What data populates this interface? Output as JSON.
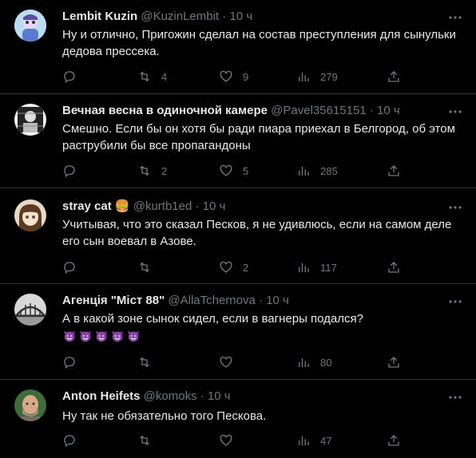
{
  "tweets": [
    {
      "name": "Lembit Kuzin",
      "handle": "@KuzinLembit",
      "dot": "·",
      "time": "10 ч",
      "text": "Ну и отлично, Пригожин сделал на состав преступления для сынульки дедова прессека.",
      "replies": "",
      "retweets": "4",
      "likes": "9",
      "views": "279"
    },
    {
      "name": "Вечная весна в одиночной камере",
      "handle": "@Pavel35615151",
      "dot": "·",
      "time": "10 ч",
      "text": "Смешно. Если бы он хотя бы ради пиара приехал в Белгород, об этом раструбили бы все пропагандоны",
      "replies": "",
      "retweets": "2",
      "likes": "5",
      "views": "285"
    },
    {
      "name": "stray cat 🍔",
      "handle": "@kurtb1ed",
      "dot": "·",
      "time": "10 ч",
      "text": "Учитывая, что это сказал Песков, я не удивлюсь, если на самом деле его сын воевал в Азове.",
      "replies": "",
      "retweets": "",
      "likes": "2",
      "views": "117"
    },
    {
      "name": "Агенція \"Міст 88\"",
      "handle": "@AllaTchernova",
      "dot": "·",
      "time": "10 ч",
      "text": "А в какой зоне сынок сидел, если в вагнеры подался?",
      "emoji_count": 5,
      "replies": "",
      "retweets": "",
      "likes": "",
      "views": "80"
    },
    {
      "name": "Anton Heifets",
      "handle": "@komoks",
      "dot": "·",
      "time": "10 ч",
      "text": "Ну так не обязательно того Пескова.",
      "replies": "",
      "retweets": "",
      "likes": "",
      "views": "47"
    }
  ],
  "colors": {
    "background": "#000000",
    "text": "#e7e9ea",
    "secondary": "#71767b",
    "divider": "#2f3336"
  },
  "icons": {
    "reply": "reply-icon",
    "retweet": "retweet-icon",
    "like": "heart-icon",
    "views": "views-icon",
    "share": "share-icon",
    "more": "more-icon"
  }
}
